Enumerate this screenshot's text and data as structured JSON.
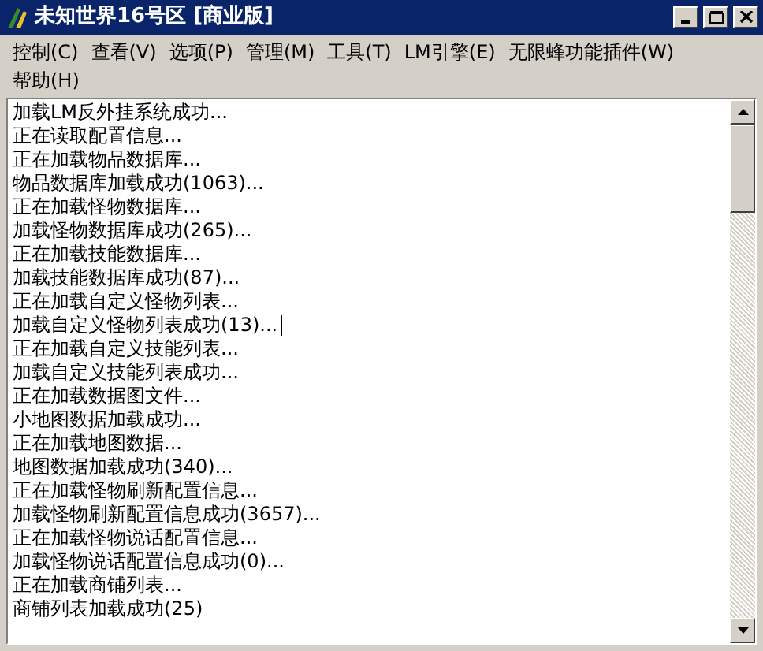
{
  "window": {
    "title": "未知世界16号区 [商业版]"
  },
  "menu": [
    "控制(C)",
    "查看(V)",
    "选项(P)",
    "管理(M)",
    "工具(T)",
    "LM引擎(E)",
    "无限蜂功能插件(W)",
    "帮助(H)"
  ],
  "log": {
    "lines": [
      {
        "text": "加载LM反外挂系统成功...",
        "caret": false
      },
      {
        "text": "正在读取配置信息...",
        "caret": false
      },
      {
        "text": "正在加载物品数据库...",
        "caret": false
      },
      {
        "text": "物品数据库加载成功(1063)...",
        "caret": false
      },
      {
        "text": "正在加载怪物数据库...",
        "caret": false
      },
      {
        "text": "加载怪物数据库成功(265)...",
        "caret": false
      },
      {
        "text": "正在加载技能数据库...",
        "caret": false
      },
      {
        "text": "加载技能数据库成功(87)...",
        "caret": false
      },
      {
        "text": "正在加载自定义怪物列表...",
        "caret": false
      },
      {
        "text": "加载自定义怪物列表成功(13)...",
        "caret": true
      },
      {
        "text": "正在加载自定义技能列表...",
        "caret": false
      },
      {
        "text": "加载自定义技能列表成功...",
        "caret": false
      },
      {
        "text": "正在加载数据图文件...",
        "caret": false
      },
      {
        "text": "小地图数据加载成功...",
        "caret": false
      },
      {
        "text": "正在加载地图数据...",
        "caret": false
      },
      {
        "text": "地图数据加载成功(340)...",
        "caret": false
      },
      {
        "text": "正在加载怪物刷新配置信息...",
        "caret": false
      },
      {
        "text": "加载怪物刷新配置信息成功(3657)...",
        "caret": false
      },
      {
        "text": "正在加载怪物说话配置信息...",
        "caret": false
      },
      {
        "text": "加载怪物说话配置信息成功(0)...",
        "caret": false
      },
      {
        "text": "正在加载商铺列表...",
        "caret": false
      },
      {
        "text": "商铺列表加载成功(25)",
        "caret": false
      }
    ]
  }
}
